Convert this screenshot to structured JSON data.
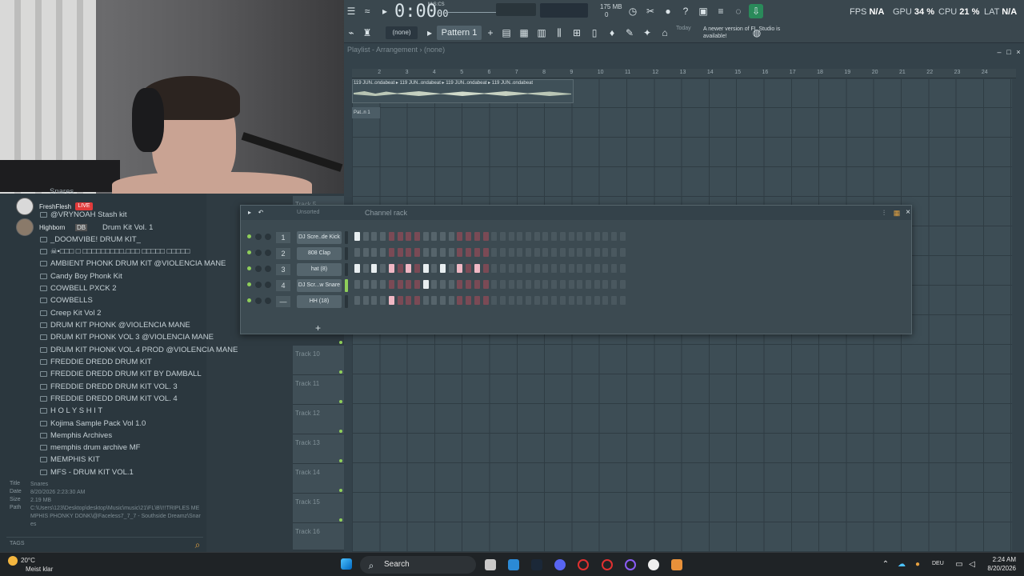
{
  "webcam": {},
  "toolbar": {
    "time_main": "0:00",
    "time_sub": "00",
    "time_unit": "M:S:CS",
    "mem_top": "175 MB",
    "mem_bottom": "0",
    "mem_left": "1",
    "pattern_none": "(none)",
    "pattern_label": "Pattern 1",
    "news_date": "Today",
    "news_text": "A newer version of FL Studio is available!",
    "fps_label": "FPS",
    "fps_value": "N/A",
    "gpu_label": "GPU",
    "gpu_value": "34 %",
    "cpu_label": "CPU",
    "cpu_value": "21 %",
    "lat_label": "LAT",
    "lat_value": "N/A"
  },
  "playlist": {
    "title": "Playlist - Arrangement",
    "pattern": "(none)",
    "ruler": [
      "2",
      "3",
      "4",
      "5",
      "6",
      "7",
      "8",
      "9",
      "10",
      "11",
      "12",
      "13",
      "14",
      "15",
      "16",
      "17",
      "18",
      "19",
      "20",
      "21",
      "22",
      "23",
      "24"
    ],
    "audio_clip_label": "119 JUN..ondabeat ▸ 119 JUN..ondabeat ▸ 119 JUN..ondabeat ▸ 119 JUN..ondabeat",
    "pattern_clip_label": "Pat..n 1",
    "tracks": [
      "Track 5",
      "Track 10",
      "Track 11",
      "Track 12",
      "Track 13",
      "Track 14",
      "Track 15",
      "Track 16"
    ]
  },
  "browser": {
    "chat": [
      {
        "name": "FreshFlesh",
        "badge": "LIVE"
      },
      {
        "name": "Highborn",
        "badge": "DB"
      }
    ],
    "top_item": "Snares",
    "folders": [
      "@VRYNOAH Stash kit",
      "Drum Kit Vol. 1",
      "_DOOMVIBE! DRUM KIT_",
      "☠•□□□ □ □□□□□□□□□.□□□ □□□□□ □□□□□",
      "AMBIENT PHONK DRUM KIT @VIOLENCIA MANE",
      "Candy Boy Phonk Kit",
      "COWBELL PXCK 2",
      "COWBELLS",
      "Creep Kit Vol 2",
      "DRUM KIT PHONK @VIOLENCIA MANE",
      "DRUM KIT PHONK VOL 3 @VIOLENCIA MANE",
      "DRUM KIT PHONK VOL.4 PROD @VIOLENCIA MANE",
      "FREDDIE DREDD DRUM KIT",
      "FREDDIE DREDD DRUM KIT BY DAMBALL",
      "FREDDIE DREDD DRUM KIT VOL. 3",
      "FREDDIE DREDD DRUM KIT VOL. 4",
      "H O L Y S H I T",
      "Kojima Sample Pack Vol 1.0",
      "Memphis Archives",
      "memphis drum archive MF",
      "MEMPHIS KIT",
      "MFS - DRUM KIT VOL.1"
    ],
    "info": {
      "title_label": "Title",
      "title_value": "Snares",
      "date_label": "Date",
      "date_value": "8/20/2026 2:23:30 AM",
      "size_label": "Size",
      "size_value": "2.19 MB",
      "path_label": "Path",
      "path_value": "C:\\Users\\123\\Desktop\\desktop\\Music\\music\\21\\FL\\B\\!!!TRIPLES MEMPHIS PHONKY DONK\\@Faceless7_7_7 - Southside Dreamz\\Snares"
    },
    "tags_label": "TAGS"
  },
  "channel_rack": {
    "title": "Channel rack",
    "filter": "Unsorted",
    "add_label": "+",
    "channels": [
      {
        "num": "1",
        "name": "DJ Scre..de Kick",
        "steps": [
          1,
          0,
          0,
          0,
          0,
          0,
          0,
          0,
          0,
          0,
          0,
          0,
          0,
          0,
          0,
          0
        ]
      },
      {
        "num": "2",
        "name": "808 Clap",
        "steps": [
          0,
          0,
          0,
          0,
          0,
          0,
          0,
          0,
          0,
          0,
          0,
          0,
          0,
          0,
          0,
          0
        ]
      },
      {
        "num": "3",
        "name": "hat (8)",
        "steps": [
          1,
          0,
          1,
          0,
          1,
          0,
          1,
          0,
          1,
          0,
          1,
          0,
          1,
          0,
          1,
          0
        ]
      },
      {
        "num": "4",
        "name": "DJ Scr...w Snare",
        "steps": [
          0,
          0,
          0,
          0,
          0,
          0,
          0,
          0,
          1,
          0,
          0,
          0,
          0,
          0,
          0,
          0
        ]
      },
      {
        "num": "—",
        "name": "HH (18)",
        "steps": [
          0,
          0,
          0,
          0,
          1,
          0,
          0,
          0,
          0,
          0,
          0,
          0,
          0,
          0,
          0,
          0
        ]
      }
    ]
  },
  "taskbar": {
    "temp": "20°C",
    "weather": "Meist klar",
    "search": "Search",
    "lang": "DEU",
    "time": "2:24 AM",
    "date": "8/20/2026"
  }
}
